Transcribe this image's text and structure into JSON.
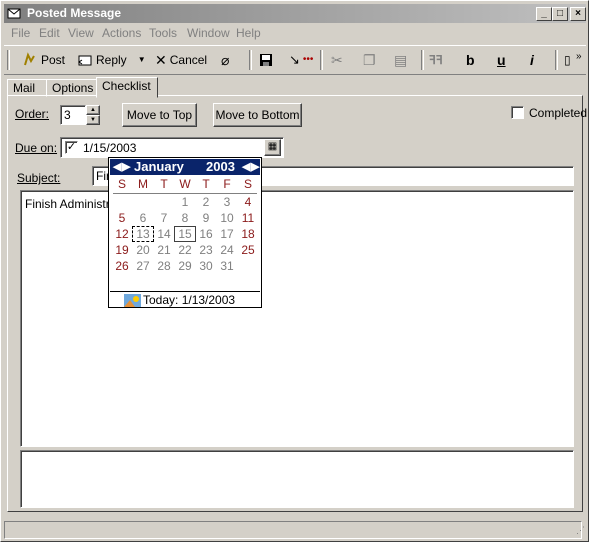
{
  "window": {
    "title": "Posted Message"
  },
  "menu": [
    "File",
    "Edit",
    "View",
    "Actions",
    "Tools",
    "Window",
    "Help"
  ],
  "toolbar": {
    "post": "Post",
    "reply": "Reply",
    "cancel": "Cancel",
    "bold": "b",
    "underline": "u",
    "italic": "i",
    "chevron": "»"
  },
  "tabs": [
    "Mail",
    "Options",
    "Checklist"
  ],
  "form": {
    "order_label": "Order:",
    "order_value": "3",
    "move_top": "Move to Top",
    "move_bottom": "Move to Bottom",
    "completed_label": "Completed",
    "due_label": "Due on:",
    "due_value": "1/15/2003",
    "subject_label": "Subject:",
    "subject_value": "Fin",
    "body_text": "Finish Administrati"
  },
  "calendar": {
    "month": "January",
    "year": "2003",
    "weekdays": [
      "S",
      "M",
      "T",
      "W",
      "T",
      "F",
      "S"
    ],
    "weeks": [
      [
        "",
        "",
        "",
        "1",
        "2",
        "3",
        "4"
      ],
      [
        "5",
        "6",
        "7",
        "8",
        "9",
        "10",
        "11"
      ],
      [
        "12",
        "13",
        "14",
        "15",
        "16",
        "17",
        "18"
      ],
      [
        "19",
        "20",
        "21",
        "22",
        "23",
        "24",
        "25"
      ],
      [
        "26",
        "27",
        "28",
        "29",
        "30",
        "31",
        ""
      ]
    ],
    "today_label": "Today: 1/13/2003",
    "colors": {
      "weekend": "#8b1a1a",
      "weekday": "#808080",
      "header": "#0a246a"
    }
  }
}
